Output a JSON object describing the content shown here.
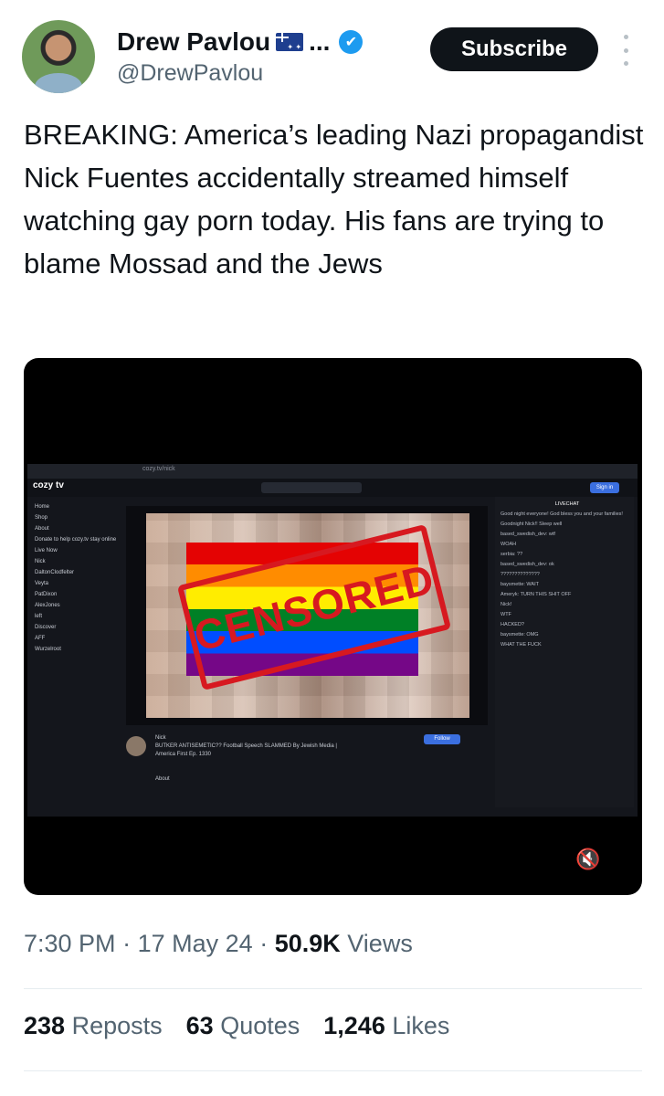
{
  "author": {
    "name": "Drew Pavlou",
    "handle": "@DrewPavlou",
    "ellipsis": "..."
  },
  "actions": {
    "subscribe_label": "Subscribe"
  },
  "tweet": {
    "text": "BREAKING: America’s leading Nazi propagandist Nick Fuentes accidentally streamed himself watching gay porn today. His fans are trying to blame Mossad and the Jews"
  },
  "media": {
    "overlay_label": "CENSORED",
    "site_logo": "cozy tv",
    "url_text": "cozy.tv/nick",
    "signin_label": "Sign in",
    "sidebar": [
      "Home",
      "Shop",
      "About",
      "Donate to help cozy.tv stay online",
      "Live Now",
      "Nick",
      "DaltonClodfelter",
      "Veyta",
      "PatDixon",
      "AlexJones",
      "left",
      "Discover",
      "AFF",
      "Wurzelroot"
    ],
    "stream_title": "Nick",
    "stream_desc": "BUTKER ANTISEMETIC?? Football Speech SLAMMED By Jewish Media | America First Ep. 1330",
    "follow_label": "Follow",
    "about_label": "About",
    "chat_header": "LIVECHAT",
    "chat_lines": [
      "Good night everyone! God bless you and your families!",
      "Goodnight Nick!! Sleep well",
      "based_swedish_dev: wtf",
      "WOAH",
      "serbia: ??",
      "based_swedish_dev: ok",
      "??????????????",
      "baysmette: WAIT",
      "Ameryk: TURN THIS SHIT OFF",
      "Nick!",
      "WTF",
      "HACKED?",
      "baysmette: OMG",
      "WHAT THE FUCK"
    ],
    "mute_icon": "speaker-muted-icon"
  },
  "meta": {
    "time": "7:30 PM",
    "date": "17 May 24",
    "views_count": "50.9K",
    "views_label": "Views",
    "separator": "·"
  },
  "stats": {
    "reposts_count": "238",
    "reposts_label": "Reposts",
    "quotes_count": "63",
    "quotes_label": "Quotes",
    "likes_count": "1,246",
    "likes_label": "Likes"
  },
  "colors": {
    "accent": "#1d9bf0",
    "text": "#0f1419",
    "muted": "#536471",
    "censor_red": "#d71920"
  }
}
